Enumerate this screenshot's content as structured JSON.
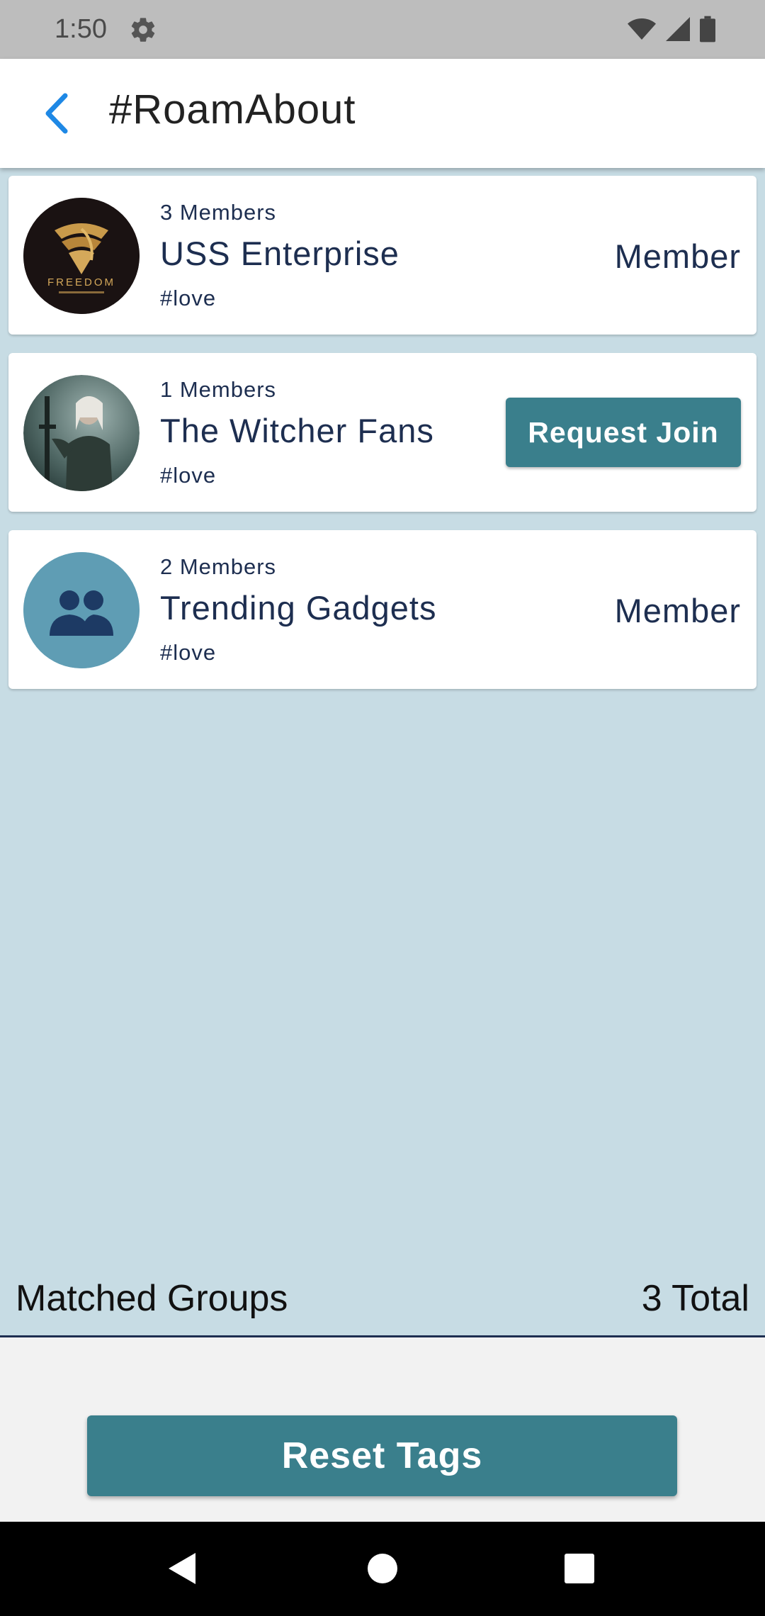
{
  "status_bar": {
    "time": "1:50",
    "icons": [
      "gear-icon",
      "wifi-icon",
      "signal-icon",
      "battery-icon"
    ]
  },
  "app_bar": {
    "title": "#RoamAbout",
    "back_icon": "chevron-left-icon"
  },
  "groups": [
    {
      "members": "3 Members",
      "name": "USS Enterprise",
      "tag": "#love",
      "status": "Member",
      "avatar": "freedom-logo"
    },
    {
      "members": "1 Members",
      "name": "The Witcher Fans",
      "tag": "#love",
      "action": "Request Join",
      "avatar": "witcher-photo"
    },
    {
      "members": "2 Members",
      "name": "Trending Gadgets",
      "tag": "#love",
      "status": "Member",
      "avatar": "group-icon"
    }
  ],
  "summary": {
    "label": "Matched Groups",
    "total": "3 Total"
  },
  "reset_button": "Reset Tags",
  "avatar_logo_text": "FREEDOM",
  "colors": {
    "accent": "#3a7f8c",
    "background": "#c7dce4",
    "text_dark": "#1d2e50",
    "back_arrow": "#1e88e5",
    "group_avatar_bg": "#5f9db4"
  }
}
